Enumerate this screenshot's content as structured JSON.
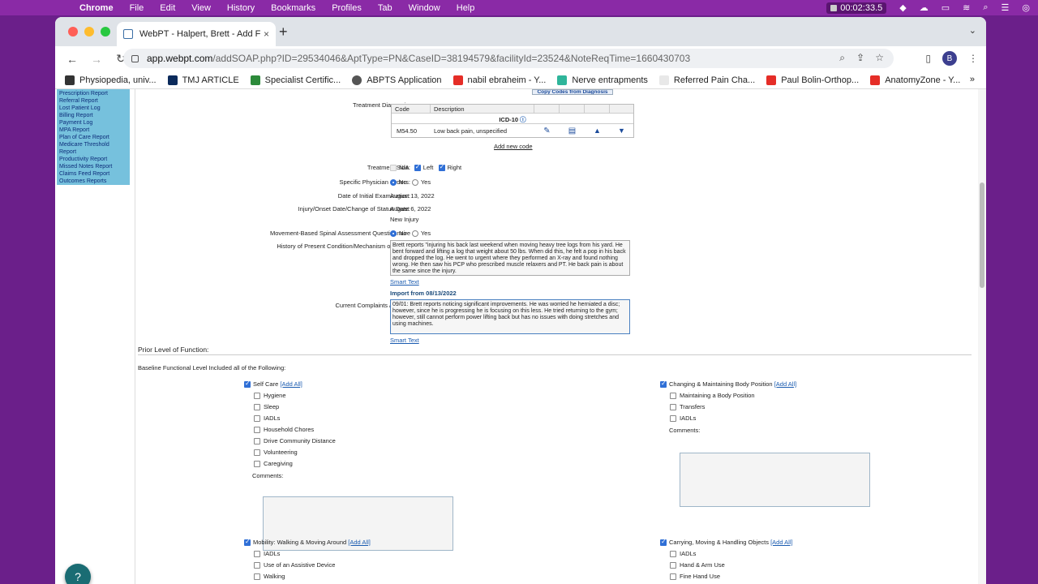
{
  "menubar": {
    "apple": "",
    "app": "Chrome",
    "items": [
      "File",
      "Edit",
      "View",
      "History",
      "Bookmarks",
      "Profiles",
      "Tab",
      "Window",
      "Help"
    ],
    "timer": "00:02:33.5"
  },
  "tab": {
    "title": "WebPT - Halpert, Brett - Add F",
    "close": "×",
    "new": "+",
    "menu": "⌄"
  },
  "toolbar": {
    "back": "←",
    "forward": "→",
    "reload": "↻",
    "domain": "app.webpt.com",
    "path": "/addSOAP.php?ID=29534046&AptType=PN&CaseID=38194579&facilityId=23524&NoteReqTime=1660430703",
    "avatar": "B"
  },
  "bookmarks": [
    {
      "label": "Physiopedia, univ...",
      "color": "#333"
    },
    {
      "label": "TMJ ARTICLE",
      "color": "#0b2a5b"
    },
    {
      "label": "Specialist Certific...",
      "color": "#2c8a3a"
    },
    {
      "label": "ABPTS Application",
      "color": "#555"
    },
    {
      "label": "nabil ebraheim - Y...",
      "color": "#e52d27"
    },
    {
      "label": "Nerve entrapments",
      "color": "#2fb59a"
    },
    {
      "label": "Referred Pain Cha...",
      "color": "#e8e8e8"
    },
    {
      "label": "Paul Bolin-Orthop...",
      "color": "#e52d27"
    },
    {
      "label": "AnatomyZone - Y...",
      "color": "#e52d27"
    }
  ],
  "bookmarks_more": "»",
  "sidebar": [
    "Prescription Report",
    "Referral Report",
    "Lost Patient Log",
    "Billing Report",
    "Payment Log",
    "MPA Report",
    "Plan of Care Report",
    "Medicare Threshold",
    "Report",
    "Productivity Report",
    "Missed Notes Report",
    "Claims Feed Report",
    "Outcomes Reports"
  ],
  "diagnosis": {
    "copy_btn": "Copy Codes from Diagnosis",
    "label": "Treatment Diagnosis:",
    "col_code": "Code",
    "col_desc": "Description",
    "system": "ICD-10",
    "code": "M54.50",
    "desc": "Low back pain, unspecified",
    "add_code": "Add new code"
  },
  "treatment_side": {
    "label": "Treatment Side:",
    "na": "N/A",
    "left": "Left",
    "right": "Right"
  },
  "physician_orders": {
    "label": "Specific Physician Orders:",
    "no": "No",
    "yes": "Yes"
  },
  "initial_exam": {
    "label": "Date of Initial Examination:",
    "value": "August 13, 2022"
  },
  "onset": {
    "label": "Injury/Onset Date/Change of Status Date:",
    "value": "August 6, 2022",
    "sub": "New Injury"
  },
  "spinal": {
    "label": "Movement-Based Spinal Assessment Questionnaire",
    "no": "No",
    "yes": "Yes"
  },
  "history": {
    "label": "History of Present Condition/Mechanism of Injury:",
    "text": "Brett reports \"injuring his back last weekend when moving heavy tree logs from his yard. He bent forward and lifting a log that weight about 50 lbs. When did this, he felt a pop in his back and dropped the log. He went to urgent where they performed an X-ray and found nothing wrong. He then saw his PCP who prescribed muscle relaxers and PT. He back pain is about the same since the injury.",
    "smart": "Smart Text"
  },
  "import": "Import from 08/13/2022",
  "complaints": {
    "label": "Current Complaints / Gains:",
    "text": "09/01: Brett reports noticing significant improvements. He was worried he herniated a disc; however, since he is progressing he is focusing on this less. He tried returning to the gym; however, still cannot perform power lifting back but has no issues with doing stretches and using machines.",
    "smart": "Smart Text"
  },
  "prior": {
    "title": "Prior Level of Function:",
    "baseline": "Baseline Functional Level Included all of the Following:"
  },
  "self_care": {
    "title": "Self Care",
    "add_all": "[Add All]",
    "items": [
      "Hygiene",
      "Sleep",
      "IADLs",
      "Household Chores",
      "Drive Community Distance",
      "Volunteering",
      "Caregiving"
    ],
    "comments": "Comments:"
  },
  "body_position": {
    "title": "Changing & Maintaining Body Position",
    "add_all": "[Add All]",
    "items": [
      "Maintaining a Body Position",
      "Transfers",
      "IADLs"
    ],
    "comments": "Comments:"
  },
  "mobility": {
    "title": "Mobility: Walking & Moving Around",
    "add_all": "[Add All]",
    "items": [
      "IADLs",
      "Use of an Assistive Device",
      "Walking"
    ]
  },
  "carrying": {
    "title": "Carrying, Moving & Handling Objects",
    "add_all": "[Add All]",
    "items": [
      "IADLs",
      "Hand & Arm Use",
      "Fine Hand Use"
    ]
  }
}
